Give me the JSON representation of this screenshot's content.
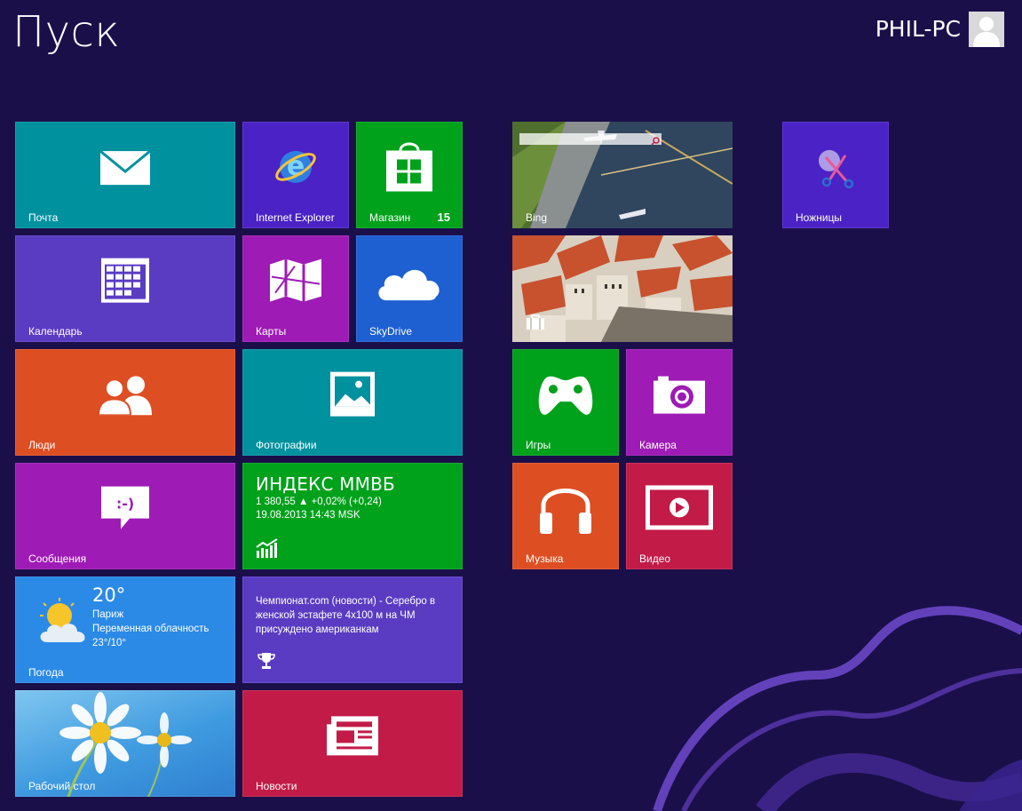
{
  "screen": {
    "title": "Пуск",
    "user_name": "PHIL-PC"
  },
  "colors": {
    "background": "#1b0f4a",
    "teal": "#00919f",
    "purple": "#5a3cc3",
    "blue": "#2d5fd8",
    "magenta": "#9e1bb5",
    "green": "#00a11b",
    "orange": "#dd4e22",
    "crimson": "#c21b47",
    "indigo": "#4b22c5"
  },
  "tiles": {
    "mail": {
      "label": "Почта",
      "icon": "mail-icon"
    },
    "ie": {
      "label": "Internet Explorer",
      "icon": "internet-explorer-icon"
    },
    "store": {
      "label": "Магазин",
      "badge": "15",
      "icon": "store-bag-icon"
    },
    "bing": {
      "label": "Bing",
      "icon": "search-icon"
    },
    "snipping": {
      "label": "Ножницы",
      "icon": "scissors-icon"
    },
    "calendar": {
      "label": "Календарь",
      "icon": "calendar-icon"
    },
    "maps": {
      "label": "Карты",
      "icon": "map-icon"
    },
    "skydrive": {
      "label": "SkyDrive",
      "icon": "cloud-icon"
    },
    "travel": {
      "icon": "suitcase-icon"
    },
    "people": {
      "label": "Люди",
      "icon": "people-icon"
    },
    "photos": {
      "label": "Фотографии",
      "icon": "photo-icon"
    },
    "games": {
      "label": "Игры",
      "icon": "gamepad-icon"
    },
    "camera": {
      "label": "Камера",
      "icon": "camera-icon"
    },
    "messages": {
      "label": "Сообщения",
      "icon": "chat-bubble-icon"
    },
    "finance": {
      "title": "ИНДЕКС ММВБ",
      "line1": "1 380,55 ▲ +0,02% (+0,24)",
      "line2": "19.08.2013 14:43 MSK",
      "icon": "finance-chart-icon"
    },
    "music": {
      "label": "Музыка",
      "icon": "headphones-icon"
    },
    "video": {
      "label": "Видео",
      "icon": "video-play-icon"
    },
    "weather": {
      "label": "Погода",
      "temp": "20°",
      "city": "Париж",
      "condition": "Переменная облачность",
      "range": "23°/10°",
      "icon": "weather-partly-cloudy-icon"
    },
    "sports": {
      "text": "Чемпионат.com (новости) - Серебро в женской эстафете 4x100 м на ЧМ присуждено американкам",
      "icon": "trophy-icon"
    },
    "desktop": {
      "label": "Рабочий стол"
    },
    "news": {
      "label": "Новости",
      "icon": "newspaper-icon"
    }
  }
}
